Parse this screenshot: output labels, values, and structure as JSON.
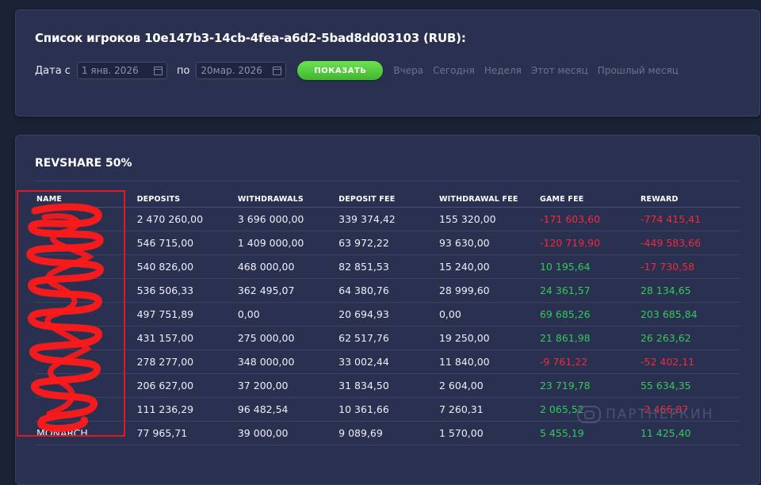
{
  "filter": {
    "title": "Список игроков 10e147b3-14cb-4fea-a6d2-5bad8dd03103 (RUB):",
    "date_from_label": "Дата с",
    "date_from_value": "1 янв. 2026",
    "date_to_label": "по",
    "date_to_value": "20мар. 2026",
    "show_button": "ПОКАЗАТЬ",
    "quick_ranges": [
      "Вчера",
      "Сегодня",
      "Неделя",
      "Этот месяц",
      "Прошлый месяц"
    ]
  },
  "report": {
    "title": "REVSHARE 50%",
    "columns": [
      "NAME",
      "DEPOSITS",
      "WITHDRAWALS",
      "DEPOSIT FEE",
      "WITHDRAWAL FEE",
      "GAME FEE",
      "REWARD"
    ],
    "rows": [
      {
        "name": "",
        "deposits": "2 470 260,00",
        "withdrawals": "3 696 000,00",
        "deposit_fee": "339 374,42",
        "withdrawal_fee": "155 320,00",
        "game_fee": "-171 603,60",
        "reward": "-774 415,41"
      },
      {
        "name": "",
        "deposits": "546 715,00",
        "withdrawals": "1 409 000,00",
        "deposit_fee": "63 972,22",
        "withdrawal_fee": "93 630,00",
        "game_fee": "-120 719,90",
        "reward": "-449 583,66"
      },
      {
        "name": "",
        "deposits": "540 826,00",
        "withdrawals": "468 000,00",
        "deposit_fee": "82 851,53",
        "withdrawal_fee": "15 240,00",
        "game_fee": "10 195,64",
        "reward": "-17 730,58"
      },
      {
        "name": "",
        "deposits": "536 506,33",
        "withdrawals": "362 495,07",
        "deposit_fee": "64 380,76",
        "withdrawal_fee": "28 999,60",
        "game_fee": "24 361,57",
        "reward": "28 134,65"
      },
      {
        "name": "",
        "deposits": "497 751,89",
        "withdrawals": "0,00",
        "deposit_fee": "20 694,93",
        "withdrawal_fee": "0,00",
        "game_fee": "69 685,26",
        "reward": "203 685,84"
      },
      {
        "name": "",
        "deposits": "431 157,00",
        "withdrawals": "275 000,00",
        "deposit_fee": "62 517,76",
        "withdrawal_fee": "19 250,00",
        "game_fee": "21 861,98",
        "reward": "26 263,62"
      },
      {
        "name": "",
        "deposits": "278 277,00",
        "withdrawals": "348 000,00",
        "deposit_fee": "33 002,44",
        "withdrawal_fee": "11 840,00",
        "game_fee": "-9 761,22",
        "reward": "-52 402,11"
      },
      {
        "name": "",
        "deposits": "206 627,00",
        "withdrawals": "37 200,00",
        "deposit_fee": "31 834,50",
        "withdrawal_fee": "2 604,00",
        "game_fee": "23 719,78",
        "reward": "55 634,35"
      },
      {
        "name": "",
        "deposits": "111 236,29",
        "withdrawals": "96 482,54",
        "deposit_fee": "10 361,66",
        "withdrawal_fee": "7 260,31",
        "game_fee": "2 065,52",
        "reward": "-2 466,87"
      },
      {
        "name": "MONARCH",
        "deposits": "77 965,71",
        "withdrawals": "39 000,00",
        "deposit_fee": "9 089,69",
        "withdrawal_fee": "1 570,00",
        "game_fee": "5 455,19",
        "reward": "11 425,40"
      }
    ]
  },
  "watermark": "ПАРТНЕРКИН",
  "colors": {
    "background": "#1c2236",
    "card": "#2a3150",
    "accent_button": "#4cc93a",
    "negative": "#f02a3c",
    "positive": "#34c95a",
    "redaction": "#e01a25"
  }
}
